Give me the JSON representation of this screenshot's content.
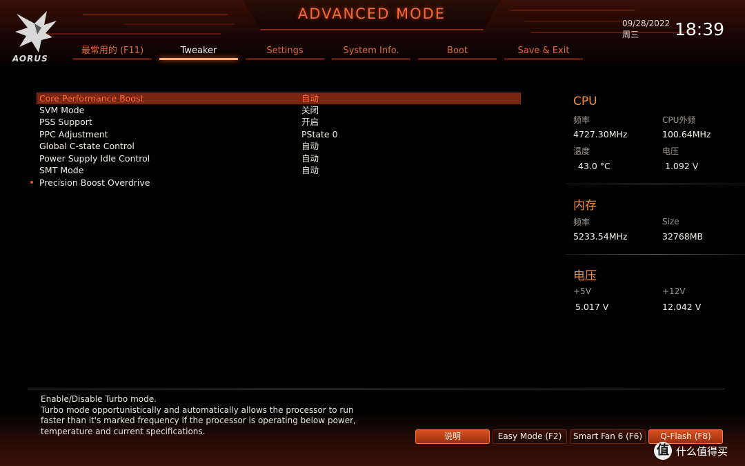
{
  "header": {
    "title": "ADVANCED MODE",
    "logo_text": "AORUS",
    "date": "09/28/2022",
    "weekday": "周三",
    "time": "18:39"
  },
  "tabs": [
    {
      "label": "最常用的 (F11)",
      "active": false
    },
    {
      "label": "Tweaker",
      "active": true
    },
    {
      "label": "Settings",
      "active": false
    },
    {
      "label": "System Info.",
      "active": false
    },
    {
      "label": "Boot",
      "active": false
    },
    {
      "label": "Save & Exit",
      "active": false
    }
  ],
  "settings": [
    {
      "name": "Core Performance Boost",
      "value": "自动",
      "selected": true
    },
    {
      "name": "SVM Mode",
      "value": "关闭"
    },
    {
      "name": "PSS Support",
      "value": "开启"
    },
    {
      "name": "PPC Adjustment",
      "value": "PState 0"
    },
    {
      "name": "Global C-state Control",
      "value": "自动"
    },
    {
      "name": "Power Supply Idle Control",
      "value": "自动"
    },
    {
      "name": "SMT Mode",
      "value": "自动"
    },
    {
      "name": "Precision Boost Overdrive",
      "value": "",
      "submenu": true
    }
  ],
  "panel": {
    "cpu": {
      "title": "CPU",
      "freq_label": "频率",
      "freq": "4727.30MHz",
      "bclk_label": "CPU外频",
      "bclk": "100.64MHz",
      "temp_label": "温度",
      "temp": "43.0 °C",
      "volt_label": "电压",
      "volt": "1.092 V"
    },
    "memory": {
      "title": "内存",
      "freq_label": "频率",
      "freq": "5233.54MHz",
      "size_label": "Size",
      "size": "32768MB"
    },
    "voltage": {
      "title": "电压",
      "v5_label": "+5V",
      "v5": "5.017 V",
      "v12_label": "+12V",
      "v12": "12.042 V"
    }
  },
  "help": {
    "lines": [
      "Enable/Disable Turbo mode.",
      "Turbo mode opportunistically and automatically allows the processor to run",
      "faster than it's marked frequency if the processor is operating below power,",
      "temperature and current specifications."
    ]
  },
  "buttons": {
    "help": "说明",
    "easy_mode": "Easy Mode (F2)",
    "smart_fan": "Smart Fan 6 (F6)",
    "qflash": "Q-Flash (F8)"
  },
  "watermark": {
    "badge": "值",
    "text": "什么值得买"
  },
  "colors": {
    "accent": "#e06838",
    "selected_row": "#7a2412",
    "section_title": "#f08c3c"
  }
}
